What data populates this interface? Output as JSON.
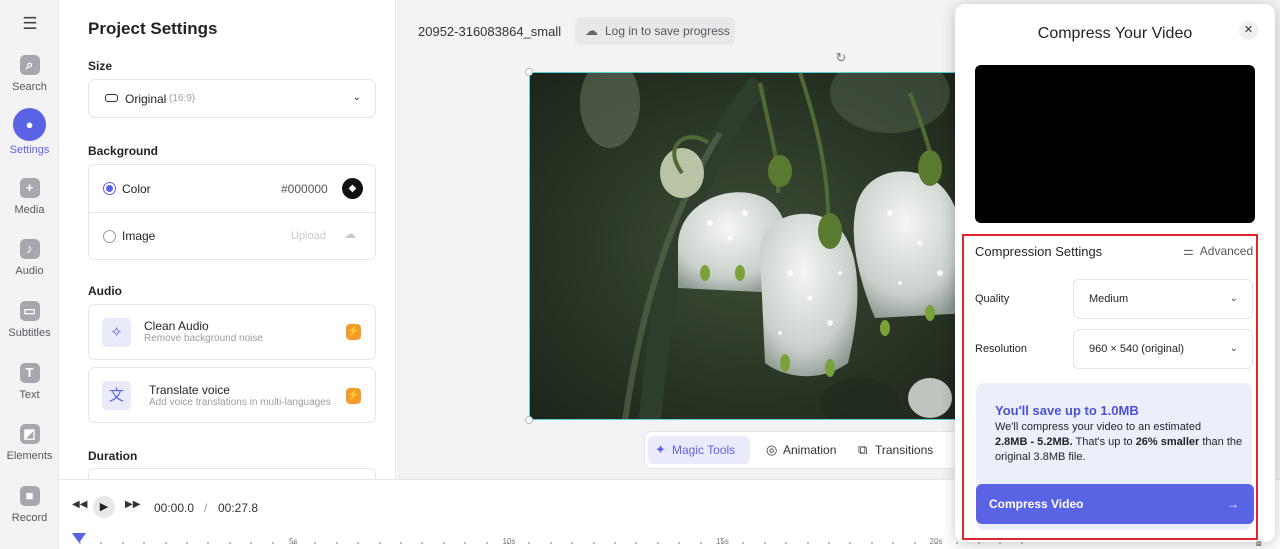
{
  "rail": {
    "items": [
      {
        "label": "Search",
        "icon": "search-icon"
      },
      {
        "label": "Settings",
        "icon": "settings-icon"
      },
      {
        "label": "Media",
        "icon": "plus-icon"
      },
      {
        "label": "Audio",
        "icon": "music-note-icon"
      },
      {
        "label": "Subtitles",
        "icon": "subtitles-icon"
      },
      {
        "label": "Text",
        "icon": "text-icon"
      },
      {
        "label": "Elements",
        "icon": "sticker-icon"
      },
      {
        "label": "Record",
        "icon": "camera-icon"
      }
    ],
    "active": "Settings"
  },
  "project": {
    "title": "Project Settings",
    "size_label": "Size",
    "size_value": "Original",
    "size_ratio": "(16:9)",
    "background_label": "Background",
    "color_label": "Color",
    "color_value": "#000000",
    "image_label": "Image",
    "upload_label": "Upload",
    "audio_label": "Audio",
    "clean_audio_title": "Clean Audio",
    "clean_audio_sub": "Remove background noise",
    "translate_title": "Translate voice",
    "translate_sub": "Add voice translations in multi-languages",
    "duration_label": "Duration"
  },
  "stage": {
    "filename": "20952-316083864_small",
    "login_label": "Log in to save progress"
  },
  "toolbar": {
    "magic": "Magic Tools",
    "animation": "Animation",
    "transitions": "Transitions"
  },
  "timeline": {
    "current": "00:00.0",
    "sep": "/",
    "total": "00:27.8",
    "labels": [
      "5s",
      "10s",
      "15s",
      "20s"
    ]
  },
  "modal": {
    "title": "Compress Your Video",
    "close": "✕",
    "settings_title": "Compression Settings",
    "advanced": "Advanced",
    "quality_label": "Quality",
    "quality_value": "Medium",
    "resolution_label": "Resolution",
    "resolution_value": "960 × 540 (original)",
    "save_heading": "You'll save up to 1.0MB",
    "save_p1": "We'll compress your video to an estimated",
    "save_range": "2.8MB - 5.2MB.",
    "save_p2": " That's up to ",
    "save_pct": "26% smaller",
    "save_p3": " than the original 3.8MB file.",
    "compress_button": "Compress Video"
  },
  "colors": {
    "accent": "#5b63e5",
    "highlight": "#e0252b",
    "bolt": "#f29c2b"
  }
}
